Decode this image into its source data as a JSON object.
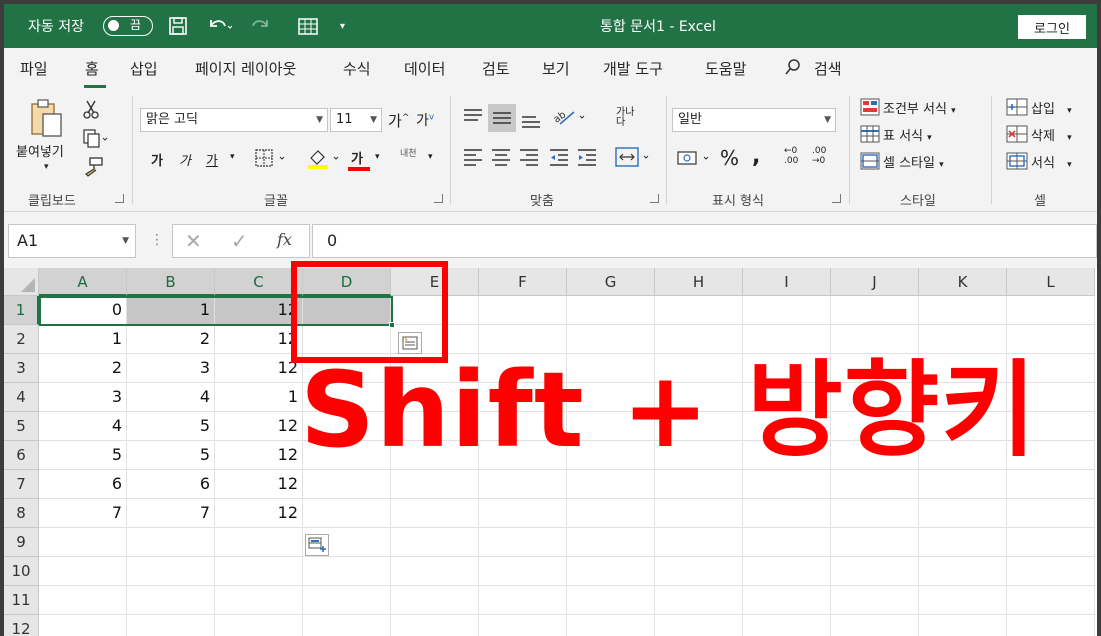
{
  "titlebar": {
    "autosave_label": "자동 저장",
    "autosave_state": "끔",
    "window_title": "통합 문서1  -  Excel",
    "login_label": "로그인"
  },
  "tabs": [
    "파일",
    "홈",
    "삽입",
    "페이지 레이아웃",
    "수식",
    "데이터",
    "검토",
    "보기",
    "개발 도구",
    "도움말"
  ],
  "search_label": "검색",
  "ribbon": {
    "clipboard": {
      "paste_label": "붙여넣기",
      "group_label": "클립보드"
    },
    "font": {
      "font_name": "맑은 고딕",
      "font_size": "11",
      "group_label": "글꼴",
      "bold": "가",
      "italic": "가",
      "underline": "가",
      "grow": "가",
      "shrink": "가",
      "font_color_glyph": "가",
      "phonetic": "내천"
    },
    "alignment": {
      "group_label": "맞춤",
      "wrap": "가나다"
    },
    "number": {
      "format": "일반",
      "group_label": "표시 형식"
    },
    "styles": {
      "conditional": "조건부 서식",
      "table": "표 서식",
      "cell_style": "셀 스타일",
      "group_label": "스타일"
    },
    "cells": {
      "insert": "삽입",
      "delete": "삭제",
      "format": "서식",
      "group_label": "셀"
    }
  },
  "formula_bar": {
    "name_box": "A1",
    "fx": "fx",
    "value": "0"
  },
  "columns": [
    "A",
    "B",
    "C",
    "D",
    "E",
    "F",
    "G",
    "H",
    "I",
    "J",
    "K",
    "L"
  ],
  "rows": [
    "1",
    "2",
    "3",
    "4",
    "5",
    "6",
    "7",
    "8",
    "9",
    "10",
    "11",
    "12"
  ],
  "cells": [
    [
      "0",
      "1",
      "12"
    ],
    [
      "1",
      "2",
      "12"
    ],
    [
      "2",
      "3",
      "12"
    ],
    [
      "3",
      "4",
      "1"
    ],
    [
      "4",
      "5",
      "12"
    ],
    [
      "5",
      "5",
      "12"
    ],
    [
      "6",
      "6",
      "12"
    ],
    [
      "7",
      "7",
      "12"
    ]
  ],
  "overlay_caption": "Shift + 방향키"
}
